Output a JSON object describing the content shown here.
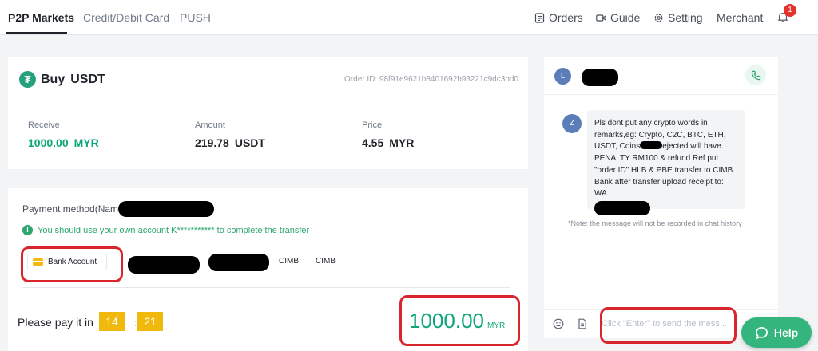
{
  "nav": {
    "tabs": [
      {
        "label": "P2P Markets",
        "active": true
      },
      {
        "label": "Credit/Debit Card",
        "active": false
      },
      {
        "label": "PUSH",
        "active": false
      }
    ],
    "orders_label": "Orders",
    "guide_label": "Guide",
    "setting_label": "Setting",
    "merchant_label": "Merchant",
    "notification_count": "1"
  },
  "order": {
    "icon": "tether-icon",
    "action": "Buy",
    "asset": "USDT",
    "order_id_label": "Order ID: 98f91e9621b8401692b93221c9dc3bd0",
    "receive_label": "Receive",
    "receive_value": "1000.00",
    "receive_unit": "MYR",
    "amount_label": "Amount",
    "amount_value": "219.78",
    "amount_unit": "USDT",
    "price_label": "Price",
    "price_value": "4.55",
    "price_unit": "MYR"
  },
  "payment": {
    "method_label": "Payment method(Name",
    "notice": "You should use your own account K*********** to complete the transfer",
    "bank_button_label": "Bank Account",
    "bank_names": [
      "CIMB",
      "CIMB"
    ],
    "pay_in_label": "Please pay it in",
    "timer_minutes": "14",
    "timer_separator": ":",
    "timer_seconds": "21",
    "total_amount": "1000.00",
    "total_currency": "MYR"
  },
  "chat": {
    "peer_initial": "L",
    "sender_initial": "Z",
    "message_line1": "Pls dont put any crypto words in remarks,eg: Crypto, C2C, BTC, ETH, USDT, Coins",
    "message_line2": "ejected will have PENALTY RM100 & refund Ref put \"order ID\" HLB & PBE transfer to CIMB Bank after transfer upload receipt to: WA",
    "note": "*Note: the message will not be recorded in chat history",
    "input_placeholder": "Click \"Enter\" to send the mess..."
  },
  "help_label": "Help",
  "colors": {
    "accent_green": "#0ca678",
    "timer_yellow": "#f0b90b",
    "annotation_red": "#d8262c"
  }
}
